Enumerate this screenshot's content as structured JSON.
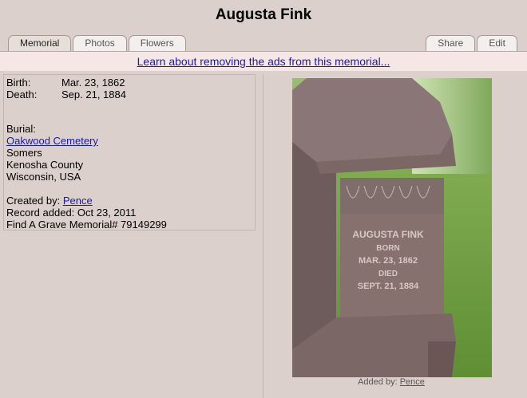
{
  "page": {
    "title": "Augusta Fink"
  },
  "tabs_left": [
    {
      "label": "Memorial",
      "active": true
    },
    {
      "label": "Photos",
      "active": false
    },
    {
      "label": "Flowers",
      "active": false
    }
  ],
  "tabs_right": [
    {
      "label": "Share"
    },
    {
      "label": "Edit"
    }
  ],
  "ad_banner": {
    "link_text": "Learn about removing the ads from this memorial..."
  },
  "memorial": {
    "birth_label": "Birth:",
    "birth_date": "Mar. 23, 1862",
    "death_label": "Death:",
    "death_date": "Sep. 21, 1884",
    "burial_label": "Burial:",
    "cemetery": "Oakwood Cemetery",
    "city": "Somers",
    "county": "Kenosha County",
    "state_country": "Wisconsin, USA",
    "created_by_label": "Created by:",
    "created_by": "Pence",
    "record_added": "Record added: Oct 23, 2011",
    "memorial_id": "Find A Grave Memorial# 79149299"
  },
  "photo": {
    "inscription": [
      "AUGUSTA FINK",
      "BORN",
      "MAR. 23, 1862",
      "DIED",
      "SEPT. 21, 1884"
    ],
    "added_by_label": "Added by:",
    "added_by": "Pence"
  },
  "colors": {
    "background": "#dcd0cc",
    "link": "#1a1aa6",
    "ad_bar": "#f6e7e7"
  }
}
